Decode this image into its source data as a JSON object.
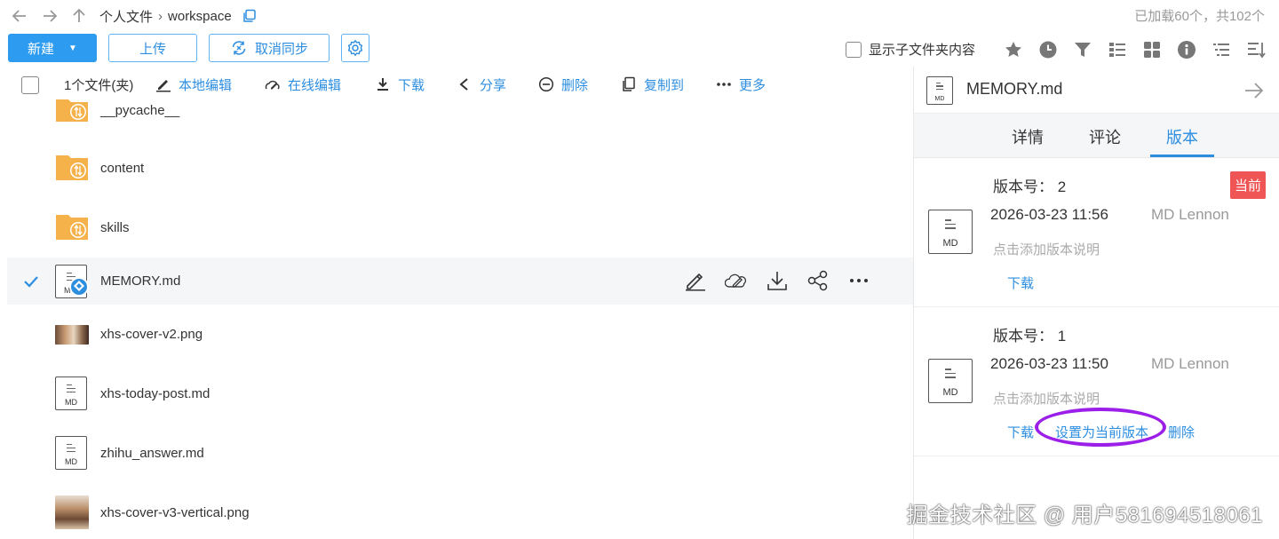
{
  "breadcrumb": {
    "root": "个人文件",
    "sep": "›",
    "current": "workspace"
  },
  "loaded_info": "已加载60个，共102个",
  "toolbar": {
    "new_label": "新建",
    "new_caret": "▼",
    "upload_label": "上传",
    "sync_label": "取消同步",
    "show_subfolder_label": "显示子文件夹内容"
  },
  "actionbar": {
    "selection_count": "1个文件(夹)",
    "local_edit": "本地编辑",
    "online_edit": "在线编辑",
    "download": "下载",
    "share": "分享",
    "delete": "删除",
    "copy_to": "复制到",
    "more": "更多"
  },
  "files": [
    {
      "name": "__pycache__",
      "type": "folder"
    },
    {
      "name": "content",
      "type": "folder"
    },
    {
      "name": "skills",
      "type": "folder"
    },
    {
      "name": "MEMORY.md",
      "type": "md",
      "selected": true,
      "icon_label": "M"
    },
    {
      "name": "xhs-cover-v2.png",
      "type": "image"
    },
    {
      "name": "xhs-today-post.md",
      "type": "md",
      "icon_label": "MD"
    },
    {
      "name": "zhihu_answer.md",
      "type": "md",
      "icon_label": "MD"
    },
    {
      "name": "xhs-cover-v3-vertical.png",
      "type": "image-tall"
    }
  ],
  "panel": {
    "file_name": "MEMORY.md",
    "file_icon_label": "MD",
    "tabs": {
      "details": "详情",
      "comments": "评论",
      "versions": "版本"
    },
    "versions": [
      {
        "label": "版本号：",
        "number": "2",
        "date": "2026-03-23 11:56",
        "user": "MD Lennon",
        "note_placeholder": "点击添加版本说明",
        "badge": "当前",
        "download": "下载",
        "icon_label": "MD"
      },
      {
        "label": "版本号：",
        "number": "1",
        "date": "2026-03-23 11:50",
        "user": "MD Lennon",
        "note_placeholder": "点击添加版本说明",
        "download": "下载",
        "set_current": "设置为当前版本",
        "delete": "删除",
        "icon_label": "MD"
      }
    ]
  },
  "watermark": "掘金技术社区 @ 用户581694518061",
  "colors": {
    "accent": "#2d9cf0",
    "link": "#2d8ee0",
    "badge": "#f05555",
    "highlight": "#9b1fe8",
    "folder": "#f6b24a"
  },
  "icons": [
    "back-icon",
    "forward-icon",
    "up-icon",
    "copy-path-icon",
    "sync-icon",
    "gear-icon",
    "star-icon",
    "clock-icon",
    "filter-icon",
    "list-view-icon",
    "grid-view-icon",
    "info-icon",
    "sort-icon",
    "sort-desc-icon",
    "edit-icon",
    "online-edit-icon",
    "download-icon",
    "share-icon",
    "delete-icon",
    "copy-icon",
    "more-icon",
    "check-icon",
    "folder-icon",
    "arrow-right-icon"
  ]
}
